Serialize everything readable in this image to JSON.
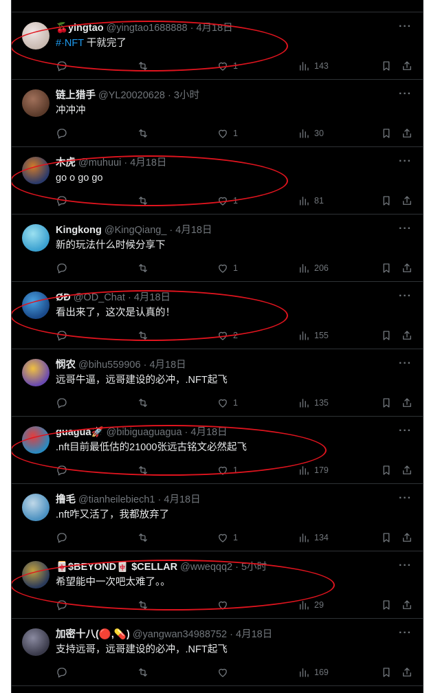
{
  "colors": {
    "background": "#000000",
    "text": "#e7e9ea",
    "muted": "#71767b",
    "link": "#1d9bf0",
    "divider": "#2f3336",
    "annotation": "#e0141e"
  },
  "more_icon": "more-dots-icon",
  "tweets": [
    {
      "name": "🍒yingtao",
      "handle": "@yingtao1688888",
      "time": "4月18日",
      "tag": "#·NFT",
      "text": " 干就完了",
      "replies": "",
      "retweets": "",
      "likes": "1",
      "views": "143",
      "avatar": [
        "#c8b9b0",
        "#f0e6e6"
      ],
      "circled": true
    },
    {
      "name": "链上猎手",
      "handle": "@YL20020628",
      "time": "3小时",
      "tag": "",
      "text": "冲冲冲",
      "replies": "",
      "retweets": "",
      "likes": "1",
      "views": "30",
      "avatar": [
        "#5a3a2a",
        "#a0705a"
      ],
      "circled": false
    },
    {
      "name": "木虎",
      "handle": "@muhuui",
      "time": "4月18日",
      "tag": "",
      "text": "go o go go",
      "replies": "",
      "retweets": "",
      "likes": "1",
      "views": "81",
      "avatar": [
        "#2b3a6a",
        "#d07a2a"
      ],
      "circled": true
    },
    {
      "name": "Kingkong",
      "handle": "@KingQiang_",
      "time": "4月18日",
      "tag": "",
      "text": "新的玩法什么时候分享下",
      "replies": "",
      "retweets": "",
      "likes": "1",
      "views": "206",
      "avatar": [
        "#3aa0d0",
        "#9be0f0"
      ],
      "circled": false
    },
    {
      "name": "ØÐ",
      "handle": "@OD_Chat",
      "time": "4月18日",
      "tag": "",
      "text": "看出来了，这次是认真的！",
      "replies": "",
      "retweets": "",
      "likes": "2",
      "views": "155",
      "avatar": [
        "#1a4a8a",
        "#4aa0e0"
      ],
      "circled": true
    },
    {
      "name": "悯农",
      "handle": "@bihu559906",
      "time": "4月18日",
      "tag": "",
      "text": "远哥牛逼，远哥建设的必冲，.NFT起飞",
      "replies": "",
      "retweets": "",
      "likes": "1",
      "views": "135",
      "avatar": [
        "#6a4ab0",
        "#f0c040"
      ],
      "circled": false
    },
    {
      "name": "guagua🚀",
      "handle": "@bibiguaguagua",
      "time": "4月18日",
      "tag": "",
      "text": ".nft目前最低估的21000张远古铭文必然起飞",
      "replies": "",
      "retweets": "",
      "likes": "1",
      "views": "179",
      "avatar": [
        "#2a8ac0",
        "#e04040"
      ],
      "circled": true
    },
    {
      "name": "撸毛",
      "handle": "@tianheilebiech1",
      "time": "4月18日",
      "tag": "",
      "text": ".nft咋又活了，我都放弃了",
      "replies": "",
      "retweets": "",
      "likes": "1",
      "views": "134",
      "avatar": [
        "#4a90c0",
        "#c0d8e8"
      ],
      "circled": false
    },
    {
      "name": "🀄$BEYOND🀄 $CELLAR",
      "handle": "@wweqqq2",
      "time": "5小时",
      "tag": "",
      "text": "希望能中一次吧太难了。。",
      "replies": "",
      "retweets": "",
      "likes": "",
      "views": "29",
      "avatar": [
        "#2a3a5a",
        "#c0a040"
      ],
      "circled": true
    },
    {
      "name": "加密十八(🔴,💊)",
      "handle": "@yangwan34988752",
      "time": "4月18日",
      "tag": "",
      "text": "支持远哥，远哥建设的必冲，.NFT起飞",
      "replies": "",
      "retweets": "",
      "likes": "",
      "views": "169",
      "avatar": [
        "#3a3a4a",
        "#8a8aa0"
      ],
      "circled": false
    }
  ]
}
